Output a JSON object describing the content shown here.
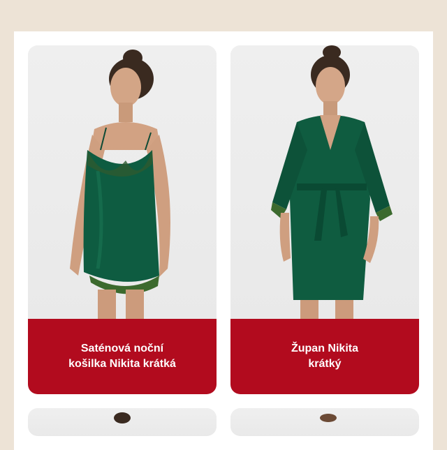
{
  "products": [
    {
      "name_line1": "Saténová noční",
      "name_line2": "košilka Nikita krátká",
      "color": "#0e5c41"
    },
    {
      "name_line1": "Župan Nikita",
      "name_line2": "krátký",
      "color": "#0f5c40"
    }
  ],
  "colors": {
    "page_bg": "#ede3d6",
    "caption_bg": "#b20b1e",
    "card_bg": "#efefef"
  }
}
